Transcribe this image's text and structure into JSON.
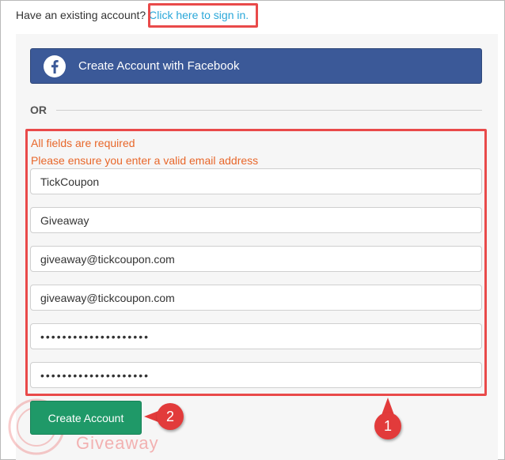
{
  "header": {
    "prompt_text": "Have an existing account?",
    "signin_link": "Click here to sign in."
  },
  "facebook_button": {
    "label": "Create Account with Facebook",
    "icon": "facebook-icon"
  },
  "divider": {
    "label": "OR"
  },
  "errors": [
    "All fields are required",
    "Please ensure you enter a valid email address"
  ],
  "fields": [
    {
      "value": "TickCoupon"
    },
    {
      "value": "Giveaway"
    },
    {
      "value": "giveaway@tickcoupon.com"
    },
    {
      "value": "giveaway@tickcoupon.com"
    },
    {
      "value": "••••••••••••••••••••"
    },
    {
      "value": "••••••••••••••••••••"
    }
  ],
  "submit": {
    "label": "Create Account"
  },
  "annotations": {
    "marker_1": "1",
    "marker_2": "2"
  },
  "watermark": {
    "text": "Giveaway"
  },
  "colors": {
    "facebook_blue": "#3b5998",
    "submit_green": "#1f9968",
    "error_orange": "#e8672a",
    "link_blue": "#2aa7d9",
    "annotation_red": "#e94a4a"
  }
}
